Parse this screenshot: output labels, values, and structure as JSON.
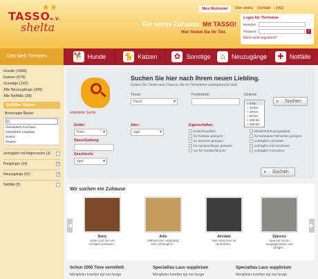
{
  "header": {
    "logo_line1": "TASSO",
    "logo_line1_small": "e.V.",
    "logo_line2": "shelta",
    "headline_main": "Ein neues Zuhause.",
    "headline_accent": "Mit TASSO!",
    "tagline": "Hier finden Sie Ihr Tier.",
    "merkzettel": "Mein Merkzettel",
    "top_links": [
      "Über shelta",
      "Kontakt",
      "FAQ"
    ]
  },
  "login": {
    "title": "Login für Tierheime",
    "user_label": "Benutzer:",
    "pass_label": "Passwort:",
    "register": "Noch nicht registriert?"
  },
  "nav": {
    "home": "Das Web-Tierheim",
    "items": [
      {
        "label": "Hunde",
        "icon": "dog-icon"
      },
      {
        "label": "Katzen",
        "icon": "cat-icon"
      },
      {
        "label": "Sonstige",
        "icon": "paw-icon"
      },
      {
        "label": "Neuzugänge",
        "icon": "house-icon"
      },
      {
        "label": "Notfälle",
        "icon": "cross-icon"
      }
    ]
  },
  "sidebar": {
    "categories": [
      "Hunde (1586)",
      "Katzen (674)",
      "Sonstige (142)",
      "Alle Neuzugänge (345)",
      "Alle Notfälle (38)"
    ],
    "filter_title": "Subfilter Katzen",
    "breed_label": "Bevorzugte Rasse:",
    "breed_query": "O|",
    "breeds": [
      "Orientalisch Kurzhaar",
      "Ostöstliche Langhaar",
      "Ocelot",
      "Oxygen"
    ],
    "checks": [
      {
        "label": "verträglich mit Artgenossen (3)",
        "checked": false
      },
      {
        "label": "Freigänger (14)",
        "checked": true
      },
      {
        "label": "Neuzugänge (32)",
        "checked": true
      },
      {
        "label": "Notfälle (5)",
        "checked": false
      }
    ]
  },
  "search": {
    "title": "Suchen Sie hier nach Ihrem neuen Liebling.",
    "subtitle": "Geben Sie Tieren eine Chance, die im Tierheimen untergebracht sind.",
    "extended": "erweiterte Suche",
    "tierart_label": "Tierart",
    "tierart_value": "Hund",
    "plz_label": "Postleitzahl",
    "umkreis_label": "Umkreis",
    "umkreis_value": "+ 0 km",
    "umkreis_options": [
      "+ 0 km",
      "+ 10 km",
      "+ 20 km",
      "+ 50 km",
      "+ 100 km",
      "+ 200 km"
    ],
    "button": "Suchen",
    "groesse_label": "Größe:",
    "groesse_value": "Klein",
    "alter_label": "Alter:",
    "alter_value": "egal",
    "rasse_label": "Rasse/Gattung:",
    "geschlecht_label": "Geschlecht:",
    "geschlecht_value": "egal",
    "eigenschaften_label": "Eigenschaften:",
    "props_left": [
      "kinderfreundlich",
      "für Familien geeignet",
      "für Senioren geeignet",
      "für Hundeanfänger geeignet",
      "nur für Hundeerfahrene"
    ],
    "props_right": [
      "Blindenführhund geeignet",
      "für behinderte Menschen geeignet",
      "verträglich mit Rüden",
      "verträglich mit Hündinnen",
      "verträglich mit Katzen"
    ],
    "button2": "Suchen"
  },
  "carousel": {
    "title": "Wir suchen ein Zuhause",
    "cards": [
      {
        "name": "Barry",
        "desc": "Hatte noch nie ein richtiges Zuhause...",
        "color": "#7a4a2a"
      },
      {
        "name": "Arko",
        "desc": "Altdeutscher Hütehund, sehr anhänglich...",
        "color": "#c49b5a"
      },
      {
        "name": "Airedale",
        "desc": "Sein Herrchen ist verstorben...",
        "color": "#3d3d3d"
      },
      {
        "name": "Spencer",
        "desc": "Spencer ist ein ausgeglichener und ruhiger...",
        "color": "#8a8a84"
      }
    ]
  },
  "bottom": {
    "items": [
      {
        "title": "Schon 1000 Tiere vermittelt.",
        "sub": "Mengfelier Indeltim eja non brege"
      },
      {
        "title": "Specialitas Laus supplicium",
        "sub": "Mengfelier Indeltim eja non brege"
      },
      {
        "title": "Specialitas Laus supplicium",
        "sub": "Mengfelier Indeltim eja non brege"
      }
    ]
  }
}
